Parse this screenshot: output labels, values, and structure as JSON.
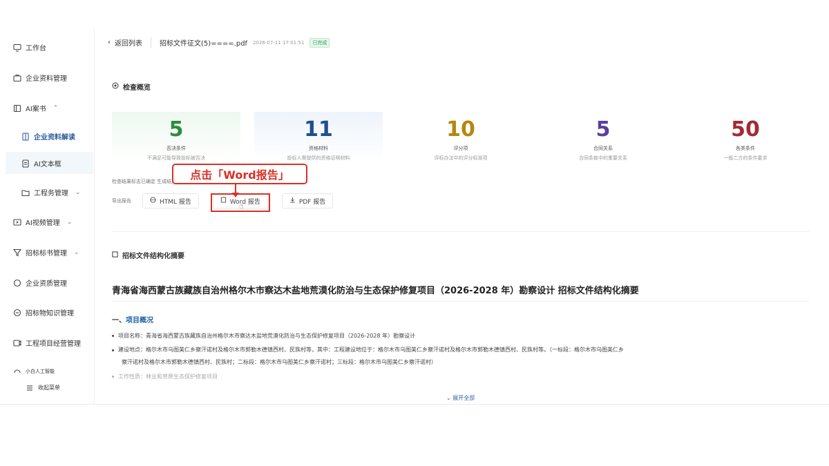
{
  "sidebar": {
    "items": [
      {
        "label": "工作台",
        "icon": "monitor-icon"
      },
      {
        "label": "企业资料管理",
        "icon": "briefcase-icon"
      },
      {
        "label": "AI案书",
        "icon": "book-icon"
      },
      {
        "label": "企业资料解读",
        "icon": "document-icon"
      },
      {
        "label": "AI文本框",
        "icon": "file-icon"
      },
      {
        "label": "工程务管理",
        "icon": "folder-icon"
      },
      {
        "label": "AI视频管理",
        "icon": "video-icon"
      },
      {
        "label": "招标标书管理",
        "icon": "filter-icon"
      },
      {
        "label": "企业资质管理",
        "icon": "circle-icon"
      },
      {
        "label": "招标物知识管理",
        "icon": "chat-icon"
      },
      {
        "label": "工程项目经营管理",
        "icon": "project-icon"
      },
      {
        "label": "小白人工智能",
        "icon": "assistant-icon"
      },
      {
        "label": "收起菜单",
        "icon": "menu-icon"
      }
    ]
  },
  "topbar": {
    "back_label": "返回列表",
    "file_name": "招标文件征文(5)====.pdf",
    "file_time": "2026-07-11 17:01:51",
    "status_badge": "已完成"
  },
  "overview": {
    "title": "检查概览",
    "stats": [
      {
        "value": "5",
        "label": "否决条件",
        "desc": "不满足可能导致投标被否决",
        "color": "#2e8b3d",
        "bg": "#eef8f0"
      },
      {
        "value": "11",
        "label": "资格材料",
        "desc": "投标人需提供的资格证明材料",
        "color": "#1f4f8f",
        "bg": "#eef4fb"
      },
      {
        "value": "10",
        "label": "评分项",
        "desc": "评标办法中的评分标准项",
        "color": "#b7860b",
        "bg": "#ffffff"
      },
      {
        "value": "5",
        "label": "合同关系",
        "desc": "合同条款中的重要关系",
        "color": "#5b3f9e",
        "bg": "#ffffff"
      },
      {
        "value": "50",
        "label": "各类条件",
        "desc": "一般二方的条件要求",
        "color": "#a32a35",
        "bg": "#ffffff"
      }
    ],
    "meta": "检查结果标志已确定 生成结束："
  },
  "export": {
    "label": "导出报告",
    "html": "HTML 报告",
    "word": "Word 报告",
    "pdf": "PDF 报告"
  },
  "callout": {
    "text": "点击「Word报告」"
  },
  "summary": {
    "section_title": "招标文件结构化摘要",
    "doc_title": "青海省海西蒙古族藏族自治州格尔木市察达木盐地荒漠化防治与生态保护修复项目（2026-2028 年）勘察设计 招标文件结构化摘要",
    "subhead_num": "一、",
    "subhead": "项目概况",
    "lines": [
      "项目名称：青海省海西蒙古族藏族自治州格尔木市察达木盐地荒漠化防治与生态保护修复项目（2026-2028 年）勘察设计",
      "建设地点：格尔木市乌图美仁乡察汗诺村及格尔木市郭勒木德镇西村、民族村等，其中：工程建设地位于：格尔木市乌图美仁乡察汗诺村及格尔木市郭勒木德镇西村、民族村等。（一标段：格尔木市乌图美仁乡",
      "察汗诺村及格尔木市郭勒木德镇西村、民族村；二标段：格尔木市乌图美仁乡察汗诺村；三标段：格尔木市乌图美仁乡察汗诺村）",
      "工作性质：林业和草原生态保护修复项目"
    ],
    "expand": "展开全部"
  }
}
